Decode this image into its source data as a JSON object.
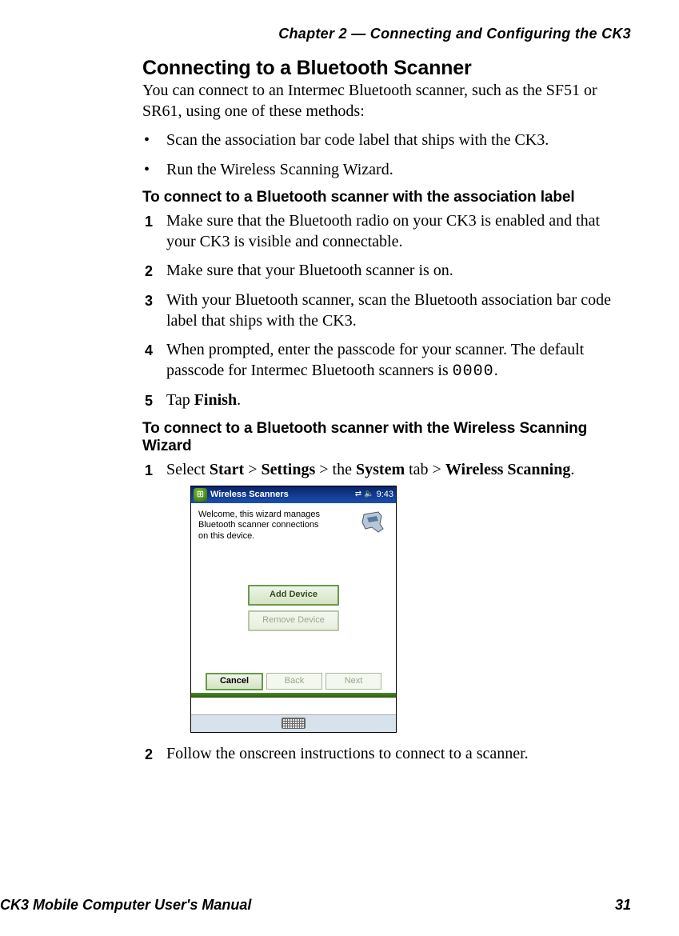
{
  "chapter_header": "Chapter 2 — Connecting and Configuring the CK3",
  "h1": "Connecting to a Bluetooth Scanner",
  "intro": "You can connect to an Intermec Bluetooth scanner, such as the SF51 or SR61, using one of these methods:",
  "bullets": [
    "Scan the association bar code label that ships with the CK3.",
    "Run the Wireless Scanning Wizard."
  ],
  "section_a_title": "To connect to a Bluetooth scanner with the association label",
  "steps_a": {
    "s1": "Make sure that the Bluetooth radio on your CK3 is enabled and that your CK3 is visible and connectable.",
    "s2": "Make sure that your Bluetooth scanner is on.",
    "s3": "With your Bluetooth scanner, scan the Bluetooth association bar code label that ships with the CK3.",
    "s4_pre": "When prompted, enter the passcode for your scanner. The default passcode for Intermec Bluetooth scanners is ",
    "s4_code": "0000",
    "s4_post": ".",
    "s5_pre": "Tap ",
    "s5_bold": "Finish",
    "s5_post": "."
  },
  "section_b_title": "To connect to a Bluetooth scanner with the Wireless Scanning Wizard",
  "steps_b": {
    "s1": {
      "t1": "Select ",
      "b1": "Start",
      "t2": " > ",
      "b2": "Settings",
      "t3": " > the ",
      "b3": "System",
      "t4": " tab > ",
      "b4": "Wireless Scanning",
      "t5": "."
    },
    "s2": "Follow the onscreen instructions to connect to a scanner."
  },
  "screenshot": {
    "title": "Wireless Scanners",
    "clock": "9:43",
    "welcome": "Welcome, this wizard manages Bluetooth scanner connections on this device.",
    "btn_add": "Add Device",
    "btn_remove": "Remove Device",
    "soft_cancel": "Cancel",
    "soft_back": "Back",
    "soft_next": "Next"
  },
  "footer_left": "CK3 Mobile Computer User's Manual",
  "footer_right": "31"
}
